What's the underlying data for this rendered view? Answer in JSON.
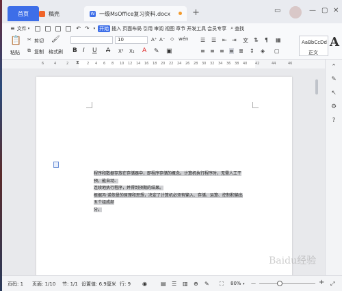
{
  "tabs": {
    "home": "首页",
    "draft": "稿壳",
    "doc": "一级MsOffice复习资料.docx",
    "doc_icon": "W"
  },
  "menu": {
    "file": "文件",
    "items": [
      "开始",
      "插入",
      "页面布局",
      "引用",
      "审阅",
      "视图",
      "章节",
      "开发工具",
      "会员专享"
    ],
    "active_index": 0,
    "search": "查找"
  },
  "ribbon": {
    "paste": "粘贴",
    "cut": "剪切",
    "copy": "复制",
    "format_painter": "格式刷",
    "font_size": "10",
    "style_preview": "AaBbCcDd",
    "style_name": "正文",
    "big_a": "A",
    "bold": "B",
    "italic": "I",
    "underline": "U",
    "strike": "A",
    "superscript": "X²",
    "subscript": "X₂",
    "font_color": "A"
  },
  "ruler": {
    "ticks": [
      "6",
      "4",
      "2",
      "2",
      "4",
      "6",
      "8",
      "10",
      "12",
      "14",
      "16",
      "18",
      "20",
      "22",
      "24",
      "26",
      "28",
      "30",
      "32",
      "34",
      "36",
      "38",
      "40",
      "42",
      "44",
      "46"
    ]
  },
  "document": {
    "lines": [
      "程序和数据存放在存储器中，即程序存储的概念。计算机执行程序时，无需人工干预，能自动、",
      "连续地执行程序，并得到预期的结果。",
      "根据冯·诺依曼的原理和思想，决定了计算机必须有输入、存储、运算、控制和输出五个组成部",
      "分。"
    ]
  },
  "status": {
    "page_no": "页码: 1",
    "pages": "页面: 1/10",
    "section": "节: 1/1",
    "setting": "设置值: 6.9厘米",
    "row": "行: 9",
    "zoom": "80%",
    "minus": "—",
    "plus": "+"
  },
  "watermark": "Baidu经验"
}
